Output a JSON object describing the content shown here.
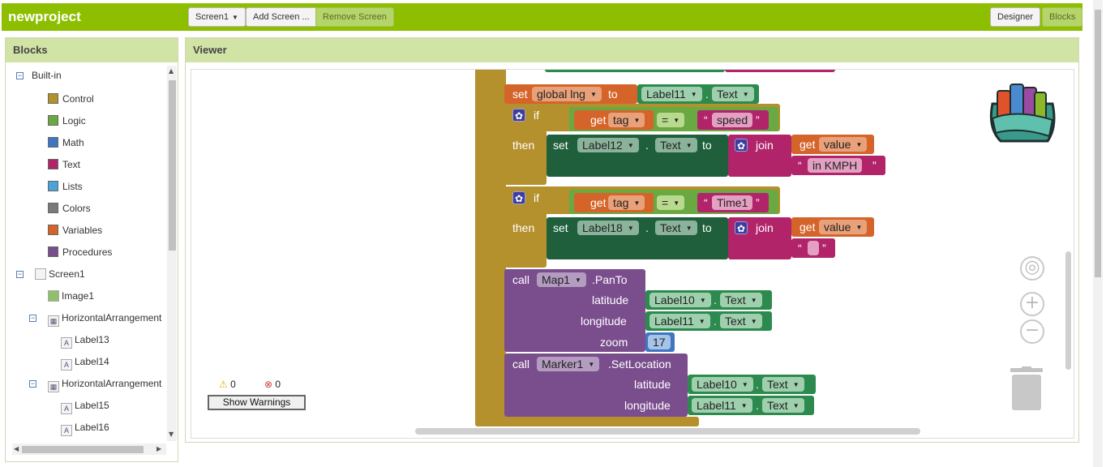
{
  "app": {
    "title": "newproject",
    "screen_select": "Screen1",
    "add_screen": "Add Screen ...",
    "remove_screen": "Remove Screen",
    "designer": "Designer",
    "blocks": "Blocks"
  },
  "blocks_panel": {
    "title": "Blocks",
    "builtin": "Built-in",
    "categories": [
      {
        "label": "Control",
        "color": "#b4912c"
      },
      {
        "label": "Logic",
        "color": "#6aa842"
      },
      {
        "label": "Math",
        "color": "#3f76c0"
      },
      {
        "label": "Text",
        "color": "#b1246a"
      },
      {
        "label": "Lists",
        "color": "#4ba4d8"
      },
      {
        "label": "Colors",
        "color": "#7a7a7a"
      },
      {
        "label": "Variables",
        "color": "#d5642a"
      },
      {
        "label": "Procedures",
        "color": "#7a4d8d"
      }
    ],
    "components": {
      "screen": "Screen1",
      "image": "Image1",
      "ha1": "HorizontalArrangement",
      "label13": "Label13",
      "label14": "Label14",
      "ha2": "HorizontalArrangement",
      "label15": "Label15",
      "label16": "Label16"
    }
  },
  "viewer": {
    "title": "Viewer",
    "warnings_count": "0",
    "errors_count": "0",
    "show_warnings": "Show Warnings"
  },
  "code": {
    "set_kw": "set",
    "to_kw": "to",
    "if_kw": "if",
    "then_kw": "then",
    "get_kw": "get",
    "join_kw": "join",
    "call_kw": "call",
    "eq": "=",
    "dot": ".",
    "lq": "“",
    "rq": "”",
    "global_lng": "global lng",
    "tag": "tag",
    "value": "value",
    "speed": "speed",
    "time1": "Time1",
    "in_kmph": "in KMPH",
    "label10": "Label10",
    "label11": "Label11",
    "label12": "Label12",
    "label18": "Label18",
    "text_prop": "Text",
    "map1": "Map1",
    "pan_to": ".PanTo",
    "marker1": "Marker1",
    "set_location": ".SetLocation",
    "latitude": "latitude",
    "longitude": "longitude",
    "zoom": "zoom",
    "zoom_val": "17"
  }
}
